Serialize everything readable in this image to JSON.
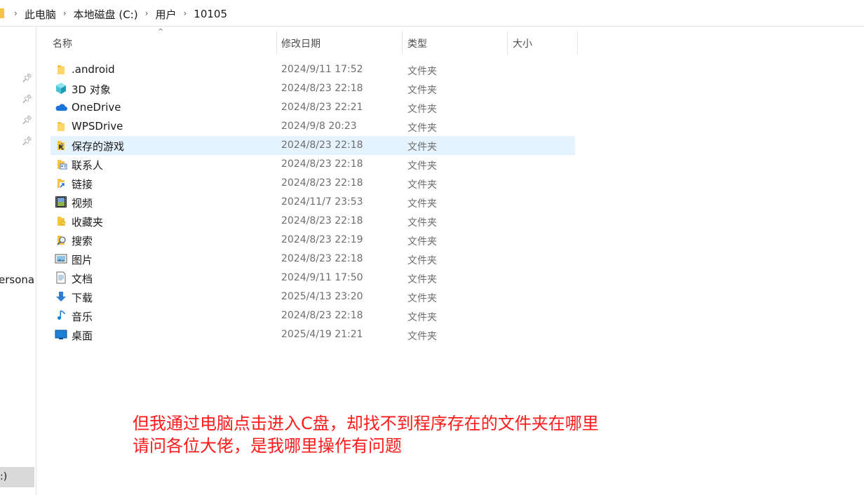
{
  "breadcrumb": {
    "items": [
      "此电脑",
      "本地磁盘 (C:)",
      "用户",
      "10105"
    ]
  },
  "nav": {
    "persona_label": "ersona",
    "c_drive_label": ":)"
  },
  "columns": {
    "name": "名称",
    "date": "修改日期",
    "type": "类型",
    "size": "大小"
  },
  "files": [
    {
      "name": ".android",
      "date": "2024/9/11 17:52",
      "type": "文件夹",
      "icon": "folder-icon"
    },
    {
      "name": "3D 对象",
      "date": "2024/8/23 22:18",
      "type": "文件夹",
      "icon": "3d-objects-icon"
    },
    {
      "name": "OneDrive",
      "date": "2024/8/23 22:21",
      "type": "文件夹",
      "icon": "onedrive-cloud-icon"
    },
    {
      "name": "WPSDrive",
      "date": "2024/9/8 20:23",
      "type": "文件夹",
      "icon": "folder-icon"
    },
    {
      "name": "保存的游戏",
      "date": "2024/8/23 22:18",
      "type": "文件夹",
      "icon": "saved-games-icon"
    },
    {
      "name": "联系人",
      "date": "2024/8/23 22:18",
      "type": "文件夹",
      "icon": "contacts-icon"
    },
    {
      "name": "链接",
      "date": "2024/8/23 22:18",
      "type": "文件夹",
      "icon": "links-icon"
    },
    {
      "name": "视频",
      "date": "2024/11/7 23:53",
      "type": "文件夹",
      "icon": "videos-icon"
    },
    {
      "name": "收藏夹",
      "date": "2024/8/23 22:18",
      "type": "文件夹",
      "icon": "favorites-icon"
    },
    {
      "name": "搜索",
      "date": "2024/8/23 22:19",
      "type": "文件夹",
      "icon": "searches-icon"
    },
    {
      "name": "图片",
      "date": "2024/8/23 22:18",
      "type": "文件夹",
      "icon": "pictures-icon"
    },
    {
      "name": "文档",
      "date": "2024/9/11 17:50",
      "type": "文件夹",
      "icon": "documents-icon"
    },
    {
      "name": "下载",
      "date": "2025/4/13 23:20",
      "type": "文件夹",
      "icon": "downloads-icon"
    },
    {
      "name": "音乐",
      "date": "2024/8/23 22:18",
      "type": "文件夹",
      "icon": "music-icon"
    },
    {
      "name": "桌面",
      "date": "2025/4/19 21:21",
      "type": "文件夹",
      "icon": "desktop-icon"
    }
  ],
  "selected_index": 4,
  "annotation": {
    "line1": "但我通过电脑点击进入C盘，却找不到程序存在的文件夹在哪里",
    "line2": "请问各位大佬，是我哪里操作有问题"
  },
  "colors": {
    "selected_row": "#e5f3ff",
    "annotation_text": "#ff1a1a",
    "folder_yellow": "#f6c445"
  }
}
